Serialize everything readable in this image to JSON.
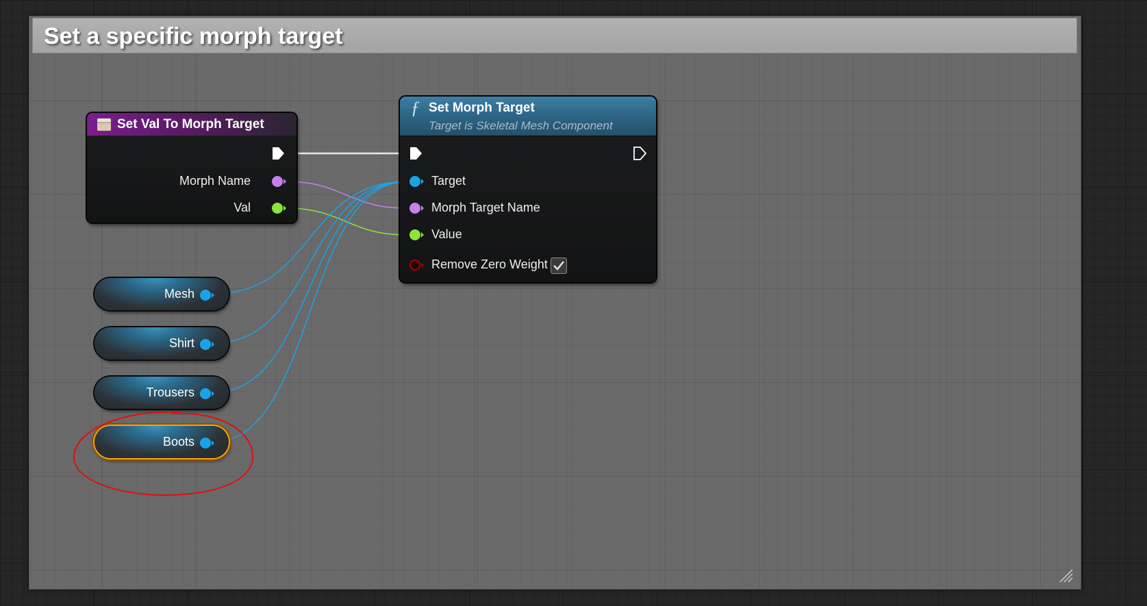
{
  "comment": {
    "title": "Set a specific morph target"
  },
  "node_set_val": {
    "title": "Set Val To Morph Target",
    "pins": {
      "morph_name": "Morph Name",
      "val": "Val"
    }
  },
  "node_set_morph": {
    "title": "Set Morph Target",
    "subtitle": "Target is Skeletal Mesh Component",
    "pins": {
      "target": "Target",
      "morph_target_name": "Morph Target Name",
      "value": "Value",
      "remove_zero_weight": "Remove Zero Weight"
    },
    "remove_zero_weight_checked": true
  },
  "variables": [
    "Mesh",
    "Shirt",
    "Trousers",
    "Boots"
  ],
  "selected_variable": "Boots",
  "colors": {
    "exec_pin": "#ffffff",
    "object_pin": "#1aa4e8",
    "name_pin": "#c77ff0",
    "float_pin": "#8ae63a",
    "bool_pin": "#9b0000",
    "selection": "#f2a319",
    "annotation": "#e01010",
    "function_header": "#2d6584",
    "event_header": "#6e1e7e"
  }
}
